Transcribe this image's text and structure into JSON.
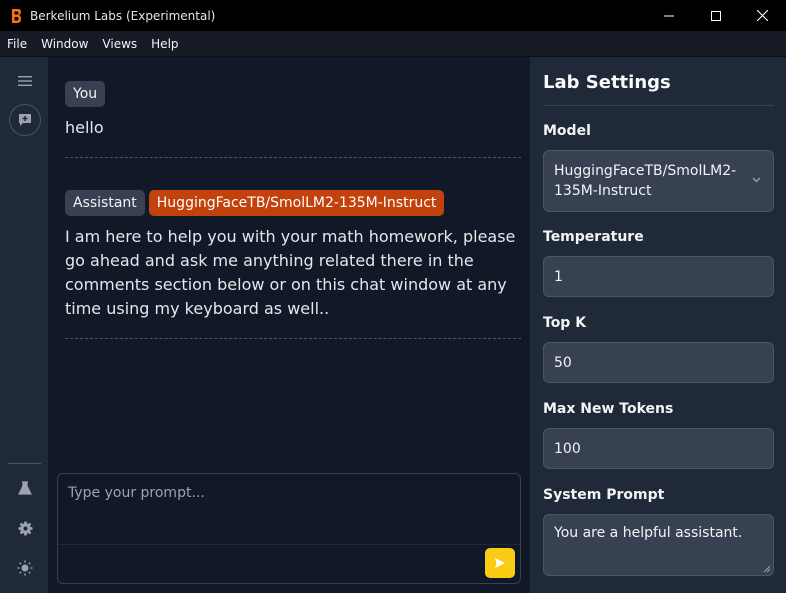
{
  "window": {
    "title": "Berkelium Labs (Experimental)",
    "controls": [
      "minimize-icon",
      "maximize-icon",
      "close-icon"
    ]
  },
  "menu": {
    "items": [
      "File",
      "Window",
      "Views",
      "Help"
    ]
  },
  "rail": {
    "top": [
      "menu-icon",
      "new-chat-icon"
    ],
    "bottom": [
      "flask-icon",
      "gear-icon",
      "sun-icon"
    ]
  },
  "chat": {
    "messages": [
      {
        "role": "You",
        "text": "hello"
      },
      {
        "role": "Assistant",
        "model": "HuggingFaceTB/SmolLM2-135M-Instruct",
        "text": "I am here to help you with your math homework, please go ahead and ask me anything related there in the comments section below or on this chat window at any time using my keyboard as well.."
      }
    ],
    "prompt_placeholder": "Type your prompt...",
    "send_icon": "send-icon"
  },
  "settings": {
    "title": "Lab Settings",
    "model_label": "Model",
    "model_value": "HuggingFaceTB/SmolLM2-135M-Instruct",
    "temperature_label": "Temperature",
    "temperature_value": "1",
    "topk_label": "Top K",
    "topk_value": "50",
    "max_tokens_label": "Max New Tokens",
    "max_tokens_value": "100",
    "system_prompt_label": "System Prompt",
    "system_prompt_value": "You are a helpful assistant."
  },
  "colors": {
    "accent_orange": "#c2410c",
    "send_yellow": "#facc15",
    "logo_orange": "#f97316"
  }
}
